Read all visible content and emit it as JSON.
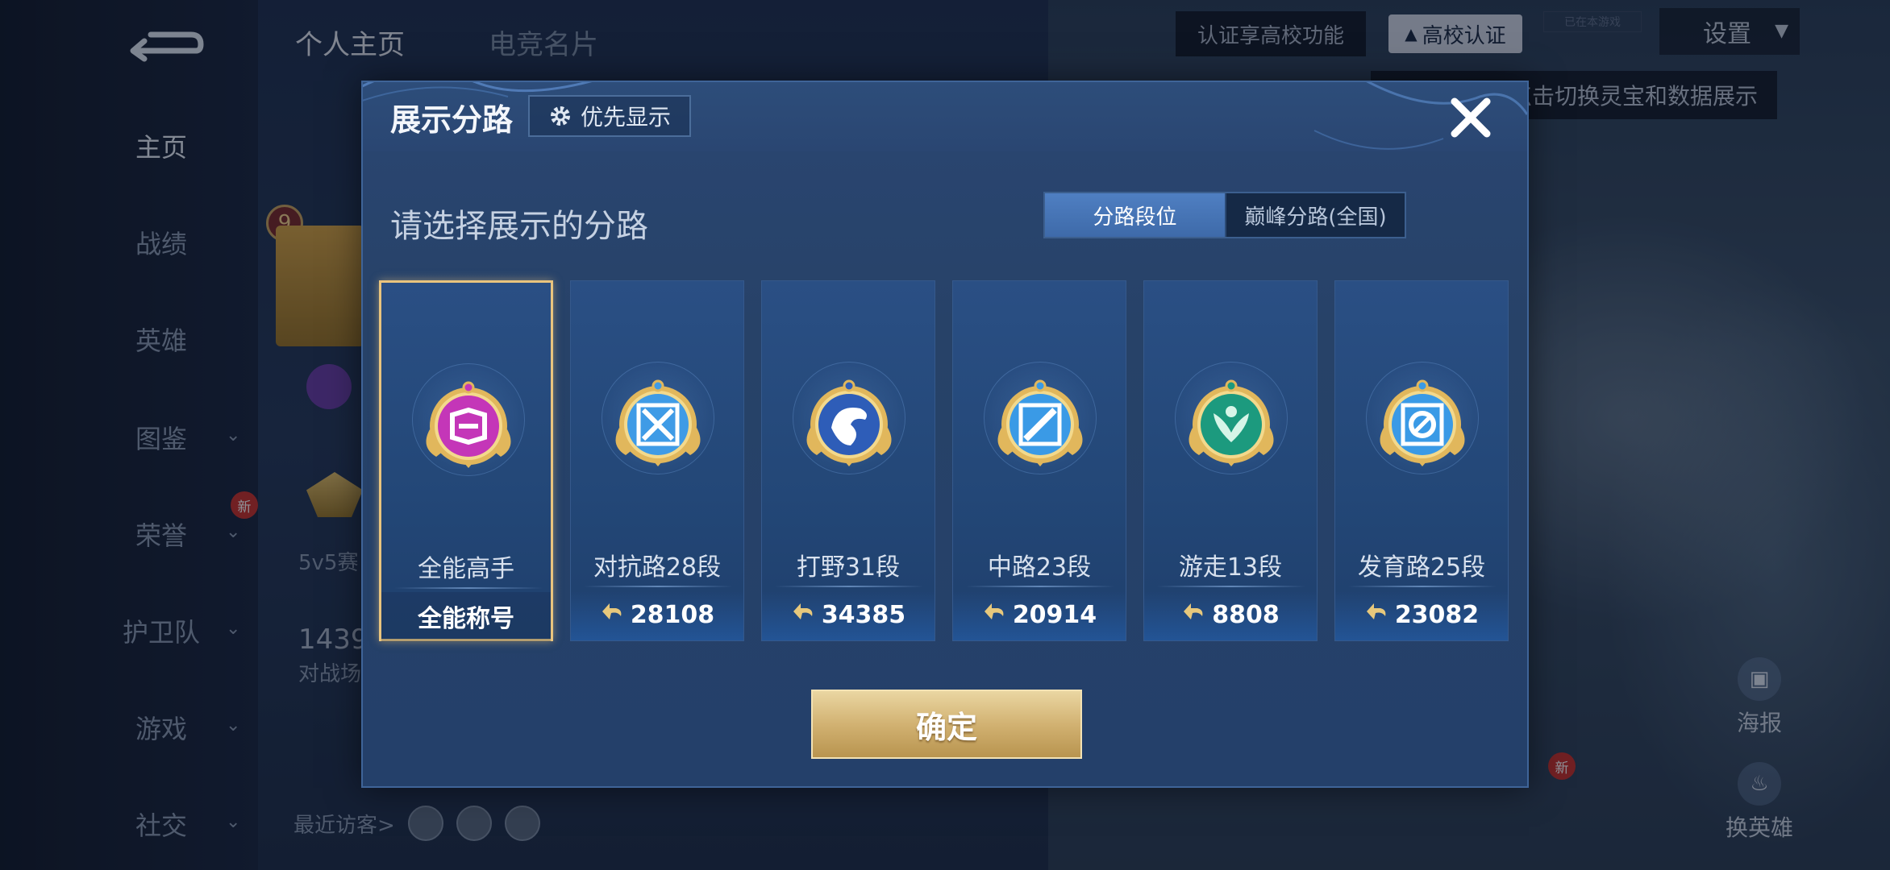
{
  "sidebar": {
    "items": [
      {
        "label": "主页",
        "active": true,
        "chevron": false
      },
      {
        "label": "战绩",
        "active": false,
        "chevron": false
      },
      {
        "label": "英雄",
        "active": false,
        "chevron": false
      },
      {
        "label": "图鉴",
        "active": false,
        "chevron": true
      },
      {
        "label": "荣誉",
        "active": false,
        "chevron": true,
        "badge": "新"
      },
      {
        "label": "护卫队",
        "active": false,
        "chevron": true
      },
      {
        "label": "游戏",
        "active": false,
        "chevron": true
      },
      {
        "label": "社交",
        "active": false,
        "chevron": true
      }
    ]
  },
  "top_tabs": [
    "个人主页",
    "电竞名片"
  ],
  "topbar": {
    "cert_hint": "认证享高校功能",
    "cert_button": "高校认证",
    "small_tag": "已在本游戏",
    "settings": "设置",
    "switch_hint": "点击切换灵宝和数据展示"
  },
  "background": {
    "level": "9",
    "mode_text": "5v5赛",
    "count": "1439",
    "count_label": "对战场",
    "visitors_label": "最近访客>",
    "poster": "海报",
    "change_hero": "换英雄",
    "new_badge": "新"
  },
  "modal": {
    "title": "展示分路",
    "priority_button": "优先显示",
    "subtitle": "请选择展示的分路",
    "segments": [
      {
        "label": "分路段位",
        "active": true
      },
      {
        "label": "巅峰分路(全国)",
        "active": false
      }
    ],
    "cards": [
      {
        "name": "全能高手",
        "value": "全能称号",
        "selected": true,
        "has_icon": false,
        "emblem": "allround-emblem",
        "color": "#c436b8"
      },
      {
        "name": "对抗路28段",
        "value": "28108",
        "selected": false,
        "has_icon": true,
        "emblem": "clash-lane-emblem",
        "color": "#3f9be6"
      },
      {
        "name": "打野31段",
        "value": "34385",
        "selected": false,
        "has_icon": true,
        "emblem": "jungle-emblem",
        "color": "#2e5db8"
      },
      {
        "name": "中路23段",
        "value": "20914",
        "selected": false,
        "has_icon": true,
        "emblem": "mid-lane-emblem",
        "color": "#3a9ae6"
      },
      {
        "name": "游走13段",
        "value": "8808",
        "selected": false,
        "has_icon": true,
        "emblem": "roam-emblem",
        "color": "#1c9a7e"
      },
      {
        "name": "发育路25段",
        "value": "23082",
        "selected": false,
        "has_icon": true,
        "emblem": "farm-lane-emblem",
        "color": "#3a9ae6"
      }
    ],
    "confirm": "确定"
  }
}
